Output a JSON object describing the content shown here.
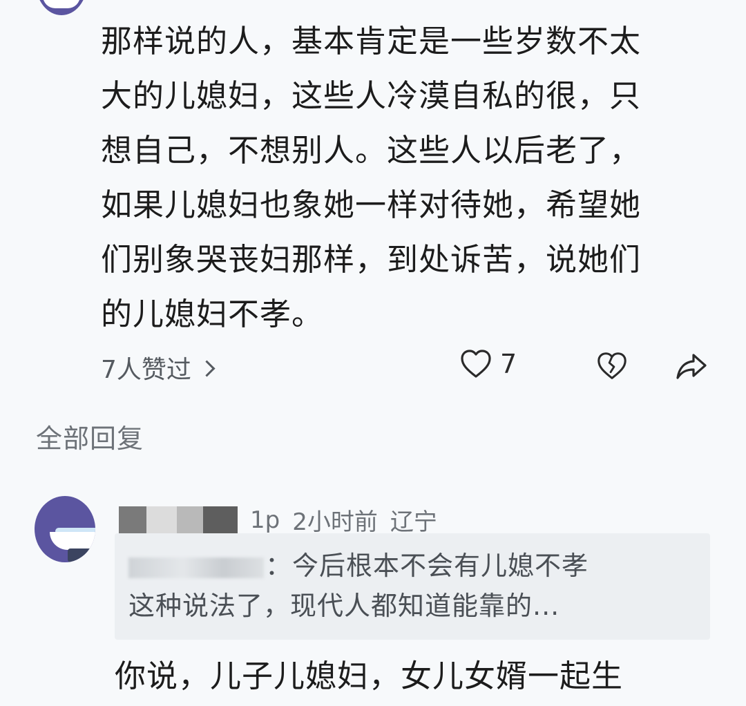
{
  "comment": {
    "lines": [
      "那样说的人，基本肯定是一些岁数不太",
      "大的儿媳妇，这些人冷漠自私的很，只",
      "想自己，不想别人。这些人以后老了，",
      "如果儿媳妇也象她一样对待她，希望她",
      "们别象哭丧妇那样，到处诉苦，说她们",
      "的儿媳妇不孝。"
    ],
    "likes_summary": "7人赞过",
    "like_count": "7",
    "icons": {
      "like": "heart-icon",
      "dislike": "broken-heart-icon",
      "share": "share-icon",
      "chevron": "chevron-right-icon"
    }
  },
  "replies_section": {
    "title": "全部回复"
  },
  "reply": {
    "floor": "1p",
    "time": "2小时前",
    "location": "辽宁",
    "quote": {
      "lines": [
        "：今后根本不会有儿媳不孝",
        "这种说法了，现代人都知道能靠的..."
      ]
    },
    "body": "你说，儿子儿媳妇，女儿女婿一起生"
  }
}
